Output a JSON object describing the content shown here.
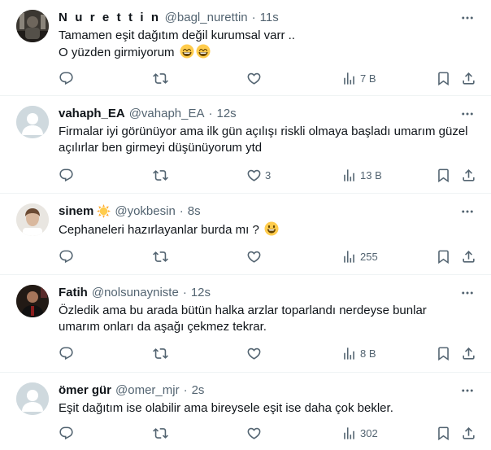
{
  "tweets": [
    {
      "display_name": "N u r e t t i n",
      "handle": "@bagl_nurettin",
      "sep": "·",
      "time": "11s",
      "lines": [
        "Tamamen eşit dağıtım değil kurumsal varr ..",
        "O yüzden girmiyorum"
      ],
      "likes": "",
      "views": "7 B"
    },
    {
      "display_name": "vahaph_EA",
      "handle": "@vahaph_EA",
      "sep": "·",
      "time": "12s",
      "lines": [
        "Firmalar iyi görünüyor ama ilk gün açılışı riskli olmaya başladı umarım güzel",
        "açılırlar ben girmeyi düşünüyorum ytd"
      ],
      "likes": "3",
      "views": "13 B"
    },
    {
      "display_name": "sinem",
      "handle": "@yokbesin",
      "sep": "·",
      "time": "8s",
      "lines": [
        "Cephaneleri hazırlayanlar burda mı ?"
      ],
      "likes": "",
      "views": "255"
    },
    {
      "display_name": "Fatih",
      "handle": "@nolsunayniste",
      "sep": "·",
      "time": "12s",
      "lines": [
        "Özledik ama bu arada bütün halka arzlar toparlandı nerdeyse bunlar",
        "umarım onları da aşağı çekmez tekrar."
      ],
      "likes": "",
      "views": "8 B"
    },
    {
      "display_name": "ömer gür",
      "handle": "@omer_mjr",
      "sep": "·",
      "time": "2s",
      "lines": [
        "Eşit dağıtım ise olabilir ama bireysele eşit ise daha çok bekler."
      ],
      "likes": "",
      "views": "302"
    }
  ],
  "icons": {
    "reply": "reply-icon",
    "retweet": "retweet-icon",
    "like": "like-icon",
    "views": "views-icon",
    "bookmark": "bookmark-icon",
    "share": "share-icon",
    "more": "more-icon"
  },
  "colors": {
    "text": "#0f1419",
    "secondary": "#536471",
    "divider": "#eff3f4"
  }
}
